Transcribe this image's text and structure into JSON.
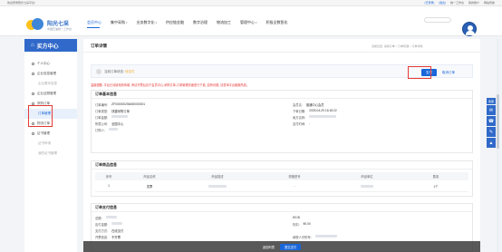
{
  "topbar": {
    "welcome": "欢迎登录阳光七采平台!",
    "login_status": "[已登录]",
    "logout": "[退出]",
    "bidding_system": "统一工作台",
    "my_account": "我的账户",
    "site_map": "网站导航"
  },
  "header": {
    "logo_name": "阳光七采",
    "logo_sub": "中国石油统一工作台",
    "nav": [
      {
        "label": "会员中心"
      },
      {
        "label": "集中采购"
      },
      {
        "label": "业务数字化"
      },
      {
        "label": "供应链金融"
      },
      {
        "label": "数字治理"
      },
      {
        "label": "物流加工"
      },
      {
        "label": "管理中心"
      },
      {
        "label": "积极全数智化"
      }
    ]
  },
  "sidebar": {
    "title": "买方中心",
    "items": [
      {
        "label": "个人中心",
        "type": "main"
      },
      {
        "label": "企业信息管理",
        "type": "main"
      },
      {
        "label": "企业基本信息",
        "type": "sub"
      },
      {
        "label": "企业证照管理",
        "type": "main"
      },
      {
        "label": "采购订单",
        "type": "main"
      },
      {
        "label": "订单管理",
        "type": "sub-active"
      },
      {
        "label": "物流订单",
        "type": "main"
      },
      {
        "label": "证书管理",
        "type": "main"
      },
      {
        "label": "证书申请",
        "type": "sub"
      },
      {
        "label": "我的证书管理",
        "type": "sub"
      }
    ]
  },
  "main": {
    "title": "订单详情",
    "breadcrumb": "当前位置: 采购订单 > 订单管理 > 订单详情",
    "status_label": "当前订单状态:",
    "status_value": "待支付",
    "pay_button": "支付",
    "cancel_link": "取消订单",
    "notice": "温馨提醒: 平台已对接电商商城, 申请开票后请于会员中心-采购订单-订单管理页面进行下载, 如有问题, 请咨询平台客服热线。",
    "basic_section_title": "订单基本信息",
    "basic": {
      "order_no_label": "订单编号:",
      "order_no": "ZF000000256450000001",
      "order_type_label": "订单类型:",
      "order_type": "快捷采购订单",
      "order_amount_label": "订单金额:",
      "company_label": "所属公司:",
      "company": "全国中心",
      "buyer_label": "订购人:",
      "member_label": "会员名:",
      "member": "普通中心会员",
      "order_time_label": "下单日期:",
      "order_time": "2025-04-29 16:18:22",
      "seller_label": "卖方名称:",
      "pay_time_label": "支付时间:",
      "pay_time": "-"
    },
    "goods_section_title": "订单商品信息",
    "goods_headers": [
      "序号",
      "商品名称",
      "商品描述",
      "规格型号",
      "商品单位",
      "数量"
    ],
    "goods_rows": [
      {
        "index": "1",
        "name": "发票",
        "desc": "",
        "spec": "-",
        "unit": "",
        "qty": "1个"
      }
    ],
    "pay_section_title": "订单支付信息",
    "pay": {
      "total_label": "总额:",
      "total": "¥0.00",
      "discount_label": "折扣:",
      "discount": "¥0.00",
      "payable_label": "应付金额:",
      "payer_label": "支付方式:",
      "payer": "在线支付",
      "invoice_label": "开票信息:",
      "invoice": "不开票",
      "payer_name_label": "纳税人识别号:",
      "payer_name": ""
    }
  },
  "footer": {
    "back": "返回列表",
    "submit": "提交支付"
  },
  "tools": {
    "label": "客服",
    "items": [
      "chat-icon",
      "phone-icon",
      "mail-icon",
      "top-icon"
    ]
  }
}
